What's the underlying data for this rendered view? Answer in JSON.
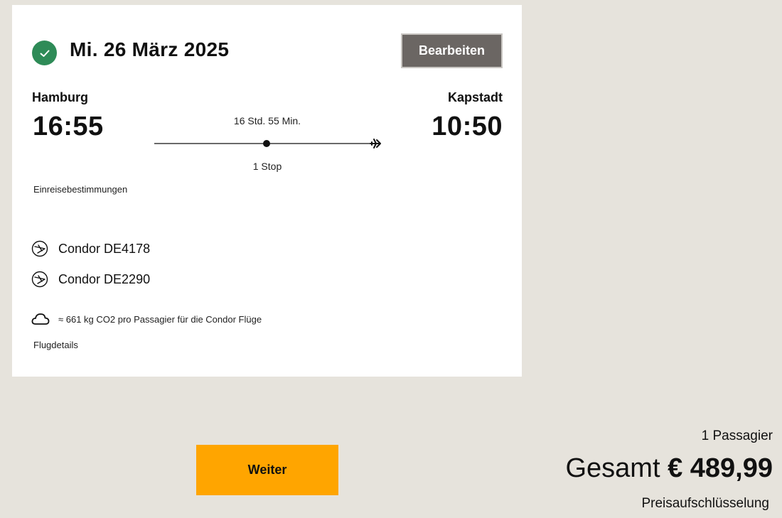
{
  "flight": {
    "date": "Mi. 26 März 2025",
    "edit_label": "Bearbeiten",
    "origin": {
      "city": "Hamburg",
      "time": "16:55"
    },
    "destination": {
      "city": "Kapstadt",
      "time": "10:50"
    },
    "duration": "16 Std. 55 Min.",
    "stops": "1 Stop",
    "entry_requirements_label": "Einreisebestimmungen",
    "airlines": [
      {
        "name": "Condor DE4178",
        "icon": "condor-logo-icon"
      },
      {
        "name": "Condor DE2290",
        "icon": "condor-logo-icon"
      }
    ],
    "co2": {
      "text": "≈ 661 kg CO2 pro Passagier für die Condor Flüge",
      "icon": "cloud-icon"
    },
    "details_label": "Flugdetails",
    "status_icon": "check-circle-icon"
  },
  "footer": {
    "continue_label": "Weiter",
    "passengers": "1 Passagier",
    "total_label": "Gesamt",
    "total_amount": "€ 489,99",
    "breakdown_label": "Preisaufschlüsselung"
  },
  "colors": {
    "background": "#e6e3dc",
    "card": "#ffffff",
    "check_green": "#2e8b57",
    "edit_button": "#6b6663",
    "continue_button": "#ffa500"
  }
}
